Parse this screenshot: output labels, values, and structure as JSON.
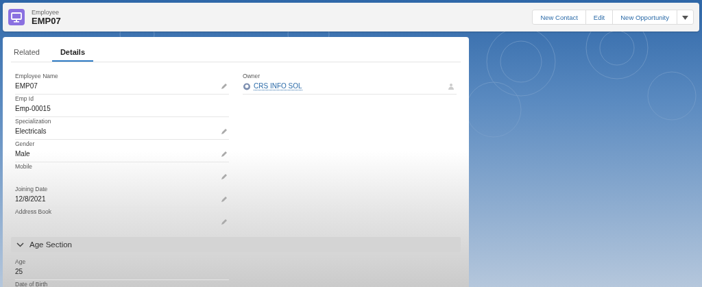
{
  "record": {
    "object": "Employee",
    "name": "EMP07"
  },
  "actions": [
    {
      "label": "New Contact"
    },
    {
      "label": "Edit"
    },
    {
      "label": "New Opportunity"
    }
  ],
  "tabs": [
    {
      "label": "Related",
      "selected": false
    },
    {
      "label": "Details",
      "selected": true
    }
  ],
  "left_fields": [
    {
      "label": "Employee Name",
      "value": "EMP07",
      "editable": true
    },
    {
      "label": "Emp Id",
      "value": "Emp-00015",
      "editable": false
    },
    {
      "label": "Specialization",
      "value": "Electricals",
      "editable": true
    },
    {
      "label": "Gender",
      "value": "Male",
      "editable": true
    },
    {
      "label": "Mobile",
      "editable": true
    },
    {
      "label": "Joining Date",
      "value": "12/8/2021",
      "editable": true
    },
    {
      "label": "Address Book",
      "editable": true
    }
  ],
  "right_fields": [
    {
      "label": "Owner",
      "value": "CRS INFO SOL",
      "kind": "user-link",
      "editable": true
    }
  ],
  "section": {
    "title": "Age Section",
    "expanded": true,
    "fields": [
      {
        "label": "Age",
        "value": "25",
        "editable": false
      },
      {
        "label": "Date of Birth"
      }
    ]
  }
}
